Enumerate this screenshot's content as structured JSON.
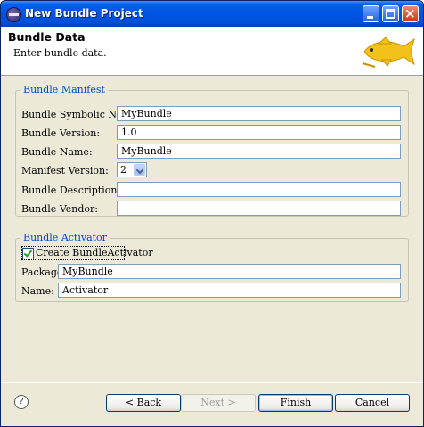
{
  "window": {
    "title": "New Bundle Project"
  },
  "banner": {
    "title": "Bundle Data",
    "subtitle": "Enter bundle data.",
    "icon": "fish-icon"
  },
  "manifest": {
    "title": "Bundle Manifest",
    "symbolic_name": {
      "label": "Bundle Symbolic Name:",
      "value": "MyBundle"
    },
    "version": {
      "label": "Bundle Version:",
      "value": "1.0"
    },
    "name": {
      "label": "Bundle Name:",
      "value": "MyBundle"
    },
    "manifest_version": {
      "label": "Manifest Version:",
      "value": "2"
    },
    "description": {
      "label": "Bundle Description:",
      "value": ""
    },
    "vendor": {
      "label": "Bundle Vendor:",
      "value": ""
    }
  },
  "activator": {
    "title": "Bundle Activator",
    "create": {
      "label": "Create BundleActivator",
      "checked": true
    },
    "package": {
      "label": "Package:",
      "value": "MyBundle"
    },
    "name": {
      "label": "Name:",
      "value": "Activator"
    }
  },
  "buttons": {
    "help": "?",
    "back": "< Back",
    "next": "Next >",
    "finish": "Finish",
    "cancel": "Cancel"
  }
}
